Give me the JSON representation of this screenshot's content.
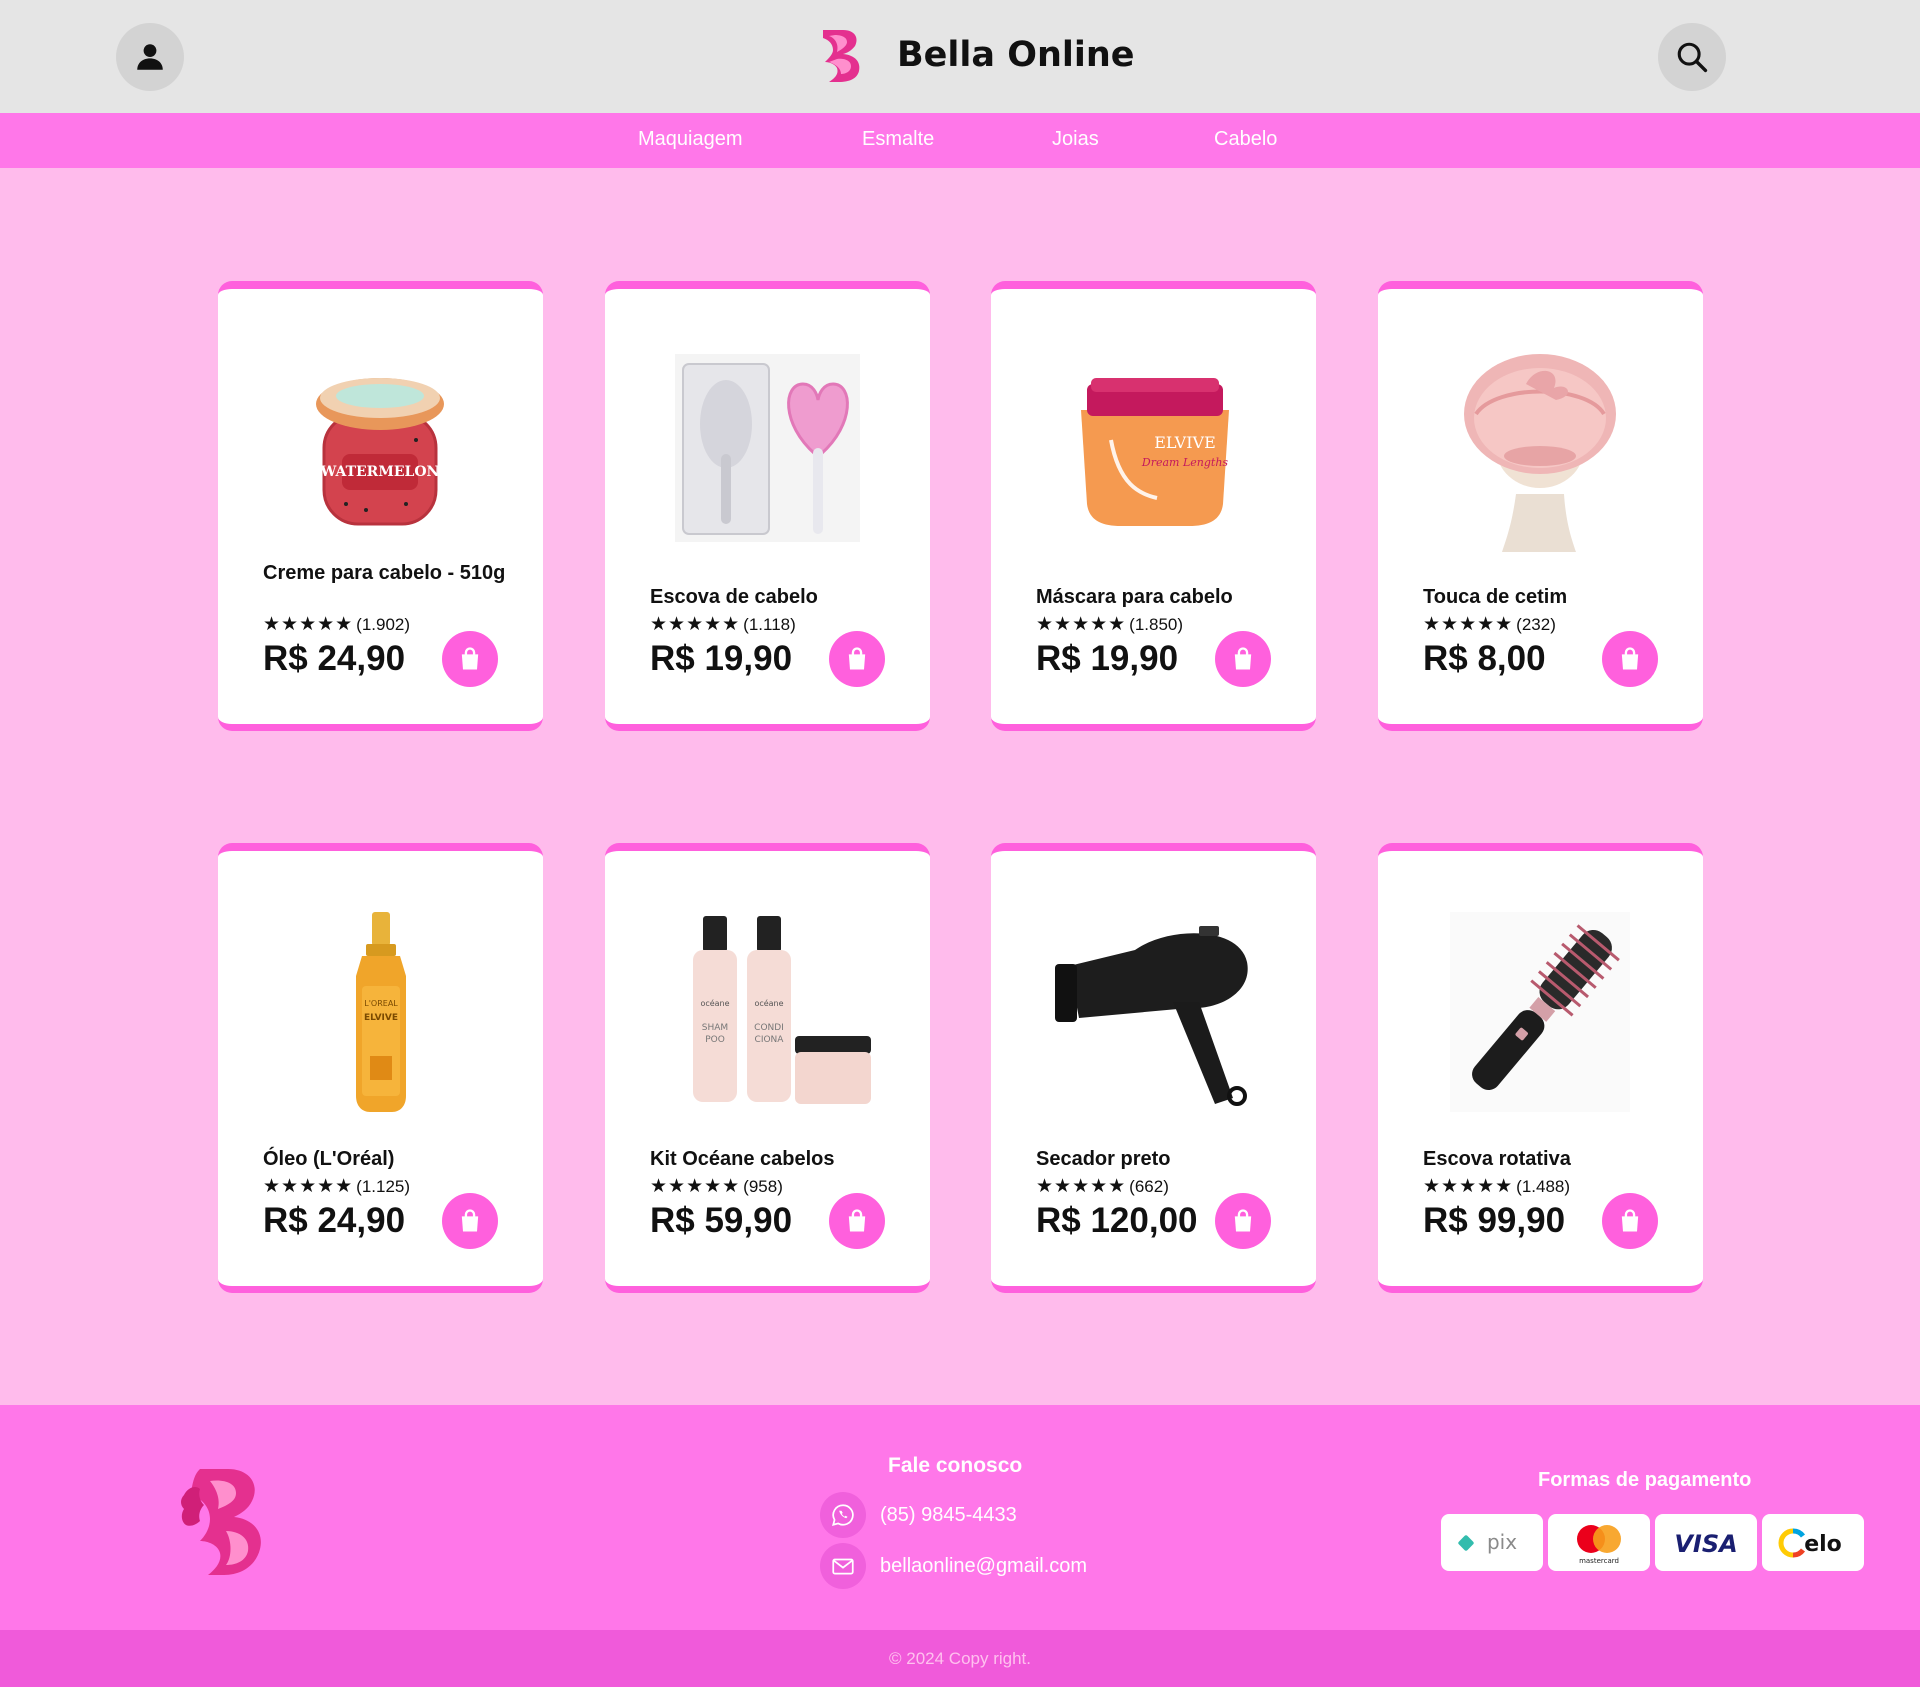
{
  "header": {
    "title": "Bella Online",
    "user_icon": "user-icon",
    "search_icon": "search-icon",
    "logo_icon": "bella-logo"
  },
  "nav": {
    "items": [
      {
        "label": "Maquiagem"
      },
      {
        "label": "Esmalte"
      },
      {
        "label": "Joias"
      },
      {
        "label": "Cabelo"
      }
    ]
  },
  "products": [
    {
      "name": "Creme para cabelo - 510g",
      "stars": "★★★★★",
      "reviews": "(1.902)",
      "price": "R$ 24,90",
      "image_icon": "watermelon-scrub-jar"
    },
    {
      "name": "Escova de cabelo",
      "stars": "★★★★★",
      "reviews": "(1.118)",
      "price": "R$ 19,90",
      "image_icon": "heart-hairbrush"
    },
    {
      "name": "Máscara para cabelo",
      "stars": "★★★★★",
      "reviews": "(1.850)",
      "price": "R$ 19,90",
      "image_icon": "hair-mask-jar"
    },
    {
      "name": "Touca de cetim",
      "stars": "★★★★★",
      "reviews": "(232)",
      "price": "R$ 8,00",
      "image_icon": "satin-bonnet"
    },
    {
      "name": "Óleo (L'Oréal)",
      "stars": "★★★★★",
      "reviews": "(1.125)",
      "price": "R$ 24,90",
      "image_icon": "hair-oil-bottle"
    },
    {
      "name": "Kit Océane cabelos",
      "stars": "★★★★★",
      "reviews": "(958)",
      "price": "R$ 59,90",
      "image_icon": "shampoo-kit"
    },
    {
      "name": "Secador preto",
      "stars": "★★★★★",
      "reviews": "(662)",
      "price": "R$ 120,00",
      "image_icon": "hair-dryer"
    },
    {
      "name": "Escova rotativa",
      "stars": "★★★★★",
      "reviews": "(1.488)",
      "price": "R$ 99,90",
      "image_icon": "rotating-brush"
    }
  ],
  "footer": {
    "contact_title": "Fale conosco",
    "phone": "(85) 9845-4433",
    "email": "bellaonline@gmail.com",
    "payment_title": "Formas de pagamento",
    "payment_methods": [
      {
        "name": "pix",
        "text": "pix"
      },
      {
        "name": "mastercard",
        "text": "mastercard"
      },
      {
        "name": "visa",
        "text": "VISA"
      },
      {
        "name": "elo",
        "text": "elo"
      }
    ],
    "copyright": "© 2024 Copy right."
  },
  "colors": {
    "page_bg": "#ffbbec",
    "nav_bg": "#ff77e9",
    "accent": "#ff60dd",
    "header_bg": "#e5e5e5",
    "bottom_bar": "#f05ada"
  }
}
